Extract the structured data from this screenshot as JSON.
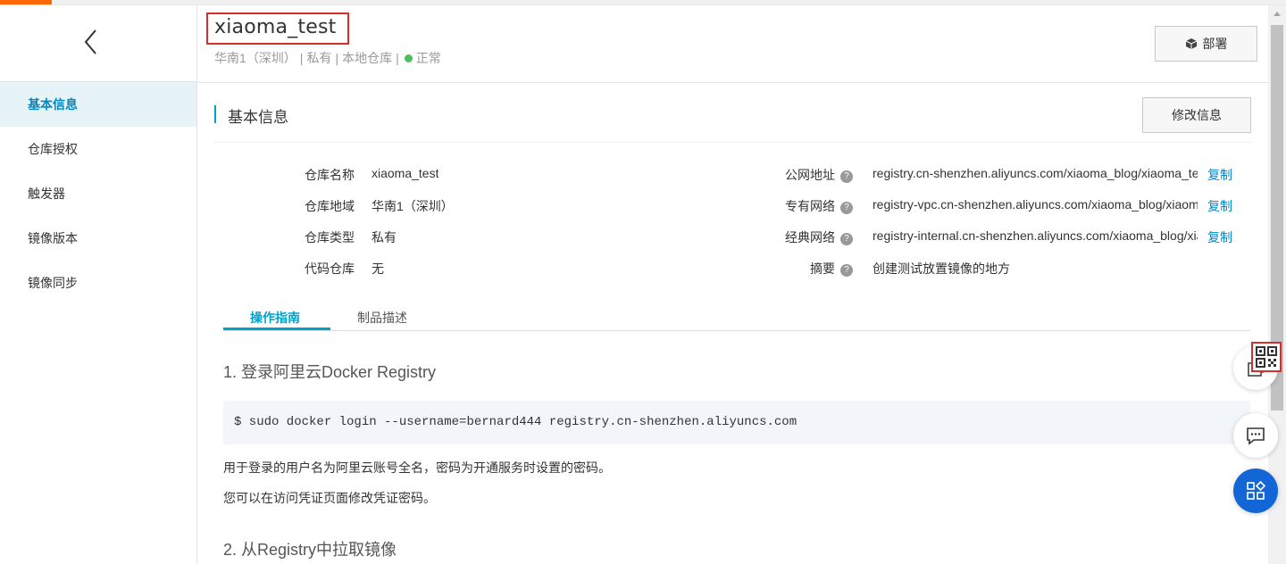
{
  "sidebar": {
    "items": [
      {
        "label": "基本信息"
      },
      {
        "label": "仓库授权"
      },
      {
        "label": "触发器"
      },
      {
        "label": "镜像版本"
      },
      {
        "label": "镜像同步"
      }
    ]
  },
  "header": {
    "title": "xiaoma_test",
    "region": "华南1（深圳）",
    "visibility": "私有",
    "repo_source": "本地仓库",
    "status": "正常",
    "status_color": "#48c15f",
    "deploy_label": "部署"
  },
  "section": {
    "title": "基本信息",
    "edit_label": "修改信息"
  },
  "info": {
    "left": [
      {
        "label": "仓库名称",
        "value": "xiaoma_test"
      },
      {
        "label": "仓库地域",
        "value": "华南1（深圳）"
      },
      {
        "label": "仓库类型",
        "value": "私有"
      },
      {
        "label": "代码仓库",
        "value": "无"
      }
    ],
    "right": [
      {
        "label": "公网地址",
        "value": "registry.cn-shenzhen.aliyuncs.com/xiaoma_blog/xiaoma_test",
        "copy": "复制"
      },
      {
        "label": "专有网络",
        "value": "registry-vpc.cn-shenzhen.aliyuncs.com/xiaoma_blog/xiaoma_test",
        "copy": "复制"
      },
      {
        "label": "经典网络",
        "value": "registry-internal.cn-shenzhen.aliyuncs.com/xiaoma_blog/xiaoma_test",
        "copy": "复制"
      },
      {
        "label": "摘要",
        "value": "创建测试放置镜像的地方"
      }
    ]
  },
  "tabs": [
    {
      "label": "操作指南"
    },
    {
      "label": "制品描述"
    }
  ],
  "guide": {
    "step1": "1. 登录阿里云Docker Registry",
    "code1": "$ sudo docker login --username=bernard444 registry.cn-shenzhen.aliyuncs.com",
    "note1": "用于登录的用户名为阿里云账号全名，密码为开通服务时设置的密码。",
    "note2": "您可以在访问凭证页面修改凭证密码。",
    "step2": "2. 从Registry中拉取镜像"
  },
  "colors": {
    "accent": "#00a2ca",
    "link": "#0088cc",
    "brand": "#ff6a00"
  }
}
